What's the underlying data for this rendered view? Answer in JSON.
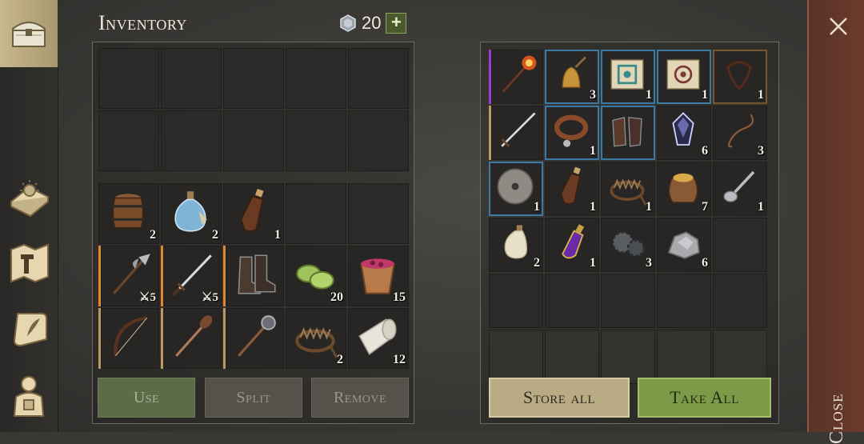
{
  "inventory": {
    "title": "Inventory",
    "currency": {
      "icon": "silver-gem-icon",
      "value": "20",
      "add_label": "+"
    },
    "equip_rows": 2,
    "items": [
      {
        "icon": "barrel-icon",
        "count": "2",
        "rarity": ""
      },
      {
        "icon": "water-flask-icon",
        "count": "2",
        "rarity": ""
      },
      {
        "icon": "leather-bottle-icon",
        "count": "1",
        "rarity": ""
      },
      {
        "icon": "",
        "count": "",
        "rarity": ""
      },
      {
        "icon": "",
        "count": "",
        "rarity": ""
      },
      {
        "icon": "halberd-icon",
        "count": "5",
        "rarity": "orange",
        "durability": true
      },
      {
        "icon": "sword-icon",
        "count": "5",
        "rarity": "orange",
        "durability": true
      },
      {
        "icon": "boots-icon",
        "count": "",
        "rarity": "orange"
      },
      {
        "icon": "green-bandage-icon",
        "count": "20",
        "rarity": ""
      },
      {
        "icon": "berry-bucket-icon",
        "count": "15",
        "rarity": ""
      },
      {
        "icon": "bow-icon",
        "count": "",
        "rarity": "tan"
      },
      {
        "icon": "spiked-mace-icon",
        "count": "",
        "rarity": "tan"
      },
      {
        "icon": "morning-star-icon",
        "count": "",
        "rarity": "tan"
      },
      {
        "icon": "bear-trap-icon",
        "count": "2",
        "rarity": ""
      },
      {
        "icon": "cloth-roll-icon",
        "count": "12",
        "rarity": ""
      }
    ],
    "buttons": {
      "use": "Use",
      "split": "Split",
      "remove": "Remove"
    }
  },
  "chest": {
    "items": [
      {
        "icon": "fire-staff-icon",
        "count": "",
        "rarity": "purple"
      },
      {
        "icon": "bell-icon",
        "count": "3",
        "rarity": "blue"
      },
      {
        "icon": "blue-scroll-icon",
        "count": "1",
        "rarity": "blue"
      },
      {
        "icon": "red-scroll-icon",
        "count": "1",
        "rarity": "blue"
      },
      {
        "icon": "harness-icon",
        "count": "1",
        "rarity": "brown"
      },
      {
        "icon": "longsword-icon",
        "count": "",
        "rarity": "tan"
      },
      {
        "icon": "collar-icon",
        "count": "1",
        "rarity": "blue"
      },
      {
        "icon": "gauntlets-icon",
        "count": "",
        "rarity": "blue"
      },
      {
        "icon": "dark-crystal-icon",
        "count": "6",
        "rarity": ""
      },
      {
        "icon": "rope-icon",
        "count": "3",
        "rarity": ""
      },
      {
        "icon": "millstone-icon",
        "count": "1",
        "rarity": "blue"
      },
      {
        "icon": "leather-bottle-icon",
        "count": "1",
        "rarity": ""
      },
      {
        "icon": "bear-trap-icon",
        "count": "1",
        "rarity": ""
      },
      {
        "icon": "grain-sack-icon",
        "count": "7",
        "rarity": ""
      },
      {
        "icon": "spoon-icon",
        "count": "1",
        "rarity": ""
      },
      {
        "icon": "milk-flask-icon",
        "count": "2",
        "rarity": ""
      },
      {
        "icon": "purple-potion-icon",
        "count": "1",
        "rarity": ""
      },
      {
        "icon": "gears-icon",
        "count": "3",
        "rarity": ""
      },
      {
        "icon": "stone-ore-icon",
        "count": "6",
        "rarity": ""
      },
      {
        "icon": "",
        "count": "",
        "rarity": ""
      }
    ],
    "buttons": {
      "store_all": "Store all",
      "take_all": "Take All"
    }
  },
  "close": {
    "label": "Close"
  },
  "sidebar": [
    {
      "icon": "chest-icon",
      "active": true
    },
    {
      "icon": "sun-book-icon",
      "active": false
    },
    {
      "icon": "crafting-map-icon",
      "active": false
    },
    {
      "icon": "quest-scroll-icon",
      "active": false
    },
    {
      "icon": "character-icon",
      "active": false
    }
  ],
  "colors": {
    "orange": "#e0892c",
    "tan": "#b89a62",
    "purple": "#a23ad0",
    "blue": "#3d7aa3",
    "brown": "#7a5630",
    "take_all": "#7d9a48",
    "store_all": "#b9ab84",
    "close_panel": "#5a3327"
  }
}
